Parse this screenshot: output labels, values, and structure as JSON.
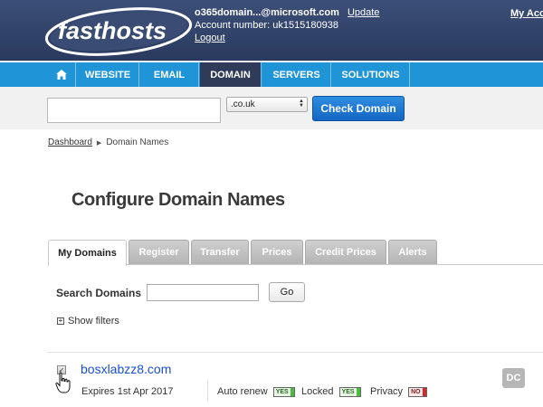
{
  "brand": {
    "logo_text": "fasthosts"
  },
  "account": {
    "email": "o365domain...@microsoft.com",
    "update_label": "Update",
    "account_number": "Account number: uk1515180938",
    "logout_label": "Logout",
    "my_account_label": "My Acc"
  },
  "nav": {
    "home_icon": "home-icon",
    "items": [
      "WEBSITE",
      "EMAIL",
      "DOMAIN",
      "SERVERS",
      "SOLUTIONS"
    ],
    "active": "DOMAIN"
  },
  "domain_search": {
    "input_value": "",
    "tld_selected": ".co.uk",
    "button_label": "Check Domain"
  },
  "breadcrumb": {
    "home": "Dashboard",
    "current": "Domain Names"
  },
  "page_title": "Configure Domain Names",
  "tabs": [
    "My Domains",
    "Register",
    "Transfer",
    "Prices",
    "Credit Prices",
    "Alerts"
  ],
  "active_tab": "My Domains",
  "search_domains": {
    "label": "Search Domains",
    "value": "",
    "go_label": "Go"
  },
  "filters_label": "Show filters",
  "domains": [
    {
      "name": "bosxlabzz8.com",
      "expires": "Expires 1st Apr 2017",
      "auto_renew_label": "Auto renew",
      "auto_renew": "YES",
      "locked_label": "Locked",
      "locked": "YES",
      "privacy_label": "Privacy",
      "privacy": "NO",
      "dc_label": "DC"
    }
  ],
  "colors": {
    "header_bg": "#2f4066",
    "nav_bg": "#1f95d8",
    "nav_active": "#2f3b59",
    "button_blue": "#1d78d2",
    "link_blue": "#1a4fd0"
  }
}
